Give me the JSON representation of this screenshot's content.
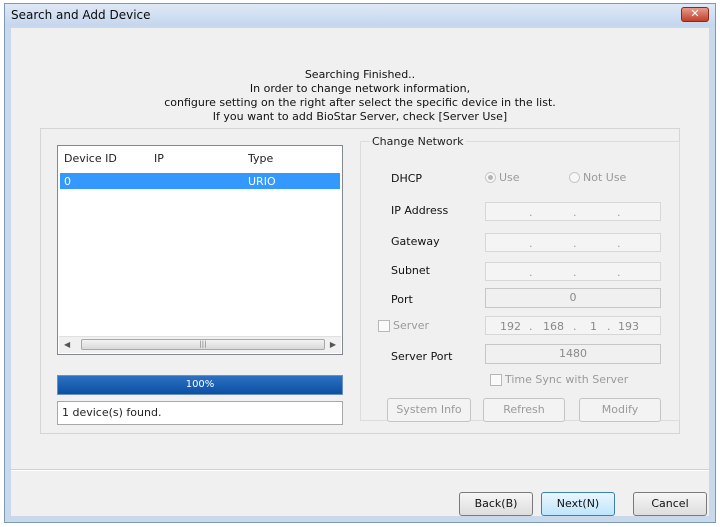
{
  "window": {
    "title": "Search and Add Device"
  },
  "message": {
    "line1": "Searching Finished..",
    "line2": "In order to change network information,",
    "line3": "configure setting on the right after select the specific device in the list.",
    "line4": "If you want to add BioStar Server, check [Server Use]"
  },
  "device_list": {
    "columns": [
      "Device ID",
      "IP",
      "Type"
    ],
    "rows": [
      {
        "device_id": "0",
        "ip": "",
        "type": "URIO"
      }
    ],
    "selected_row": 0
  },
  "progress": {
    "label": "100%",
    "value": 1.0
  },
  "status": {
    "text": "1 device(s) found."
  },
  "change_network": {
    "title": "Change Network",
    "dhcp_label": "DHCP",
    "dhcp_use": "Use",
    "dhcp_not_use": "Not Use",
    "dhcp_selected": "Use",
    "ip_address_label": "IP Address",
    "gateway_label": "Gateway",
    "subnet_label": "Subnet",
    "port_label": "Port",
    "port_value": "0",
    "server_label": "Server",
    "server_checked": false,
    "server_ip": [
      "192",
      "168",
      "1",
      "193"
    ],
    "server_port_label": "Server Port",
    "server_port_value": "1480",
    "time_sync_label": "Time Sync with Server",
    "time_sync_checked": false,
    "system_info_label": "System Info",
    "refresh_label": "Refresh",
    "modify_label": "Modify"
  },
  "footer": {
    "back_label": "Back(B)",
    "next_label": "Next(N)",
    "cancel_label": "Cancel"
  },
  "icons": {
    "close": "close-icon",
    "scroll_left": "arrow-left-icon",
    "scroll_right": "arrow-right-icon",
    "thumb_grip": "grip-icon"
  },
  "colors": {
    "selection": "#3399ff",
    "progress": "#0b4fa3",
    "title_bar": "#c4d6ee"
  }
}
